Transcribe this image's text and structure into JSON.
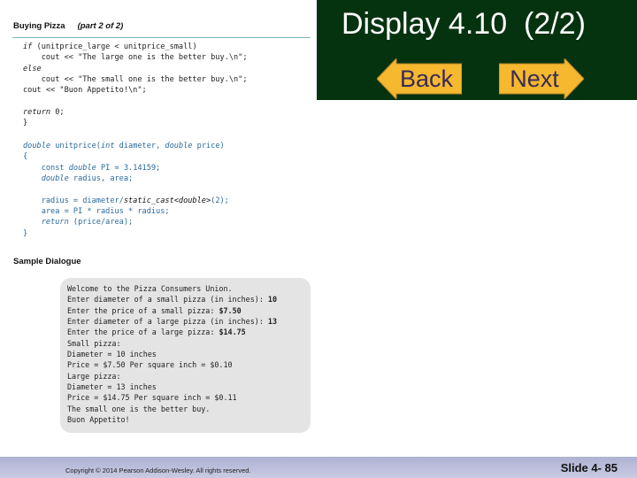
{
  "header": {
    "title": "Display 4.10  (2/2)",
    "back_label": "Back",
    "next_label": "Next",
    "panel_color": "#053310",
    "button_color": "#f5b82e"
  },
  "document": {
    "title": "Buying Pizza",
    "part": "(part 2 of 2)",
    "code_block_1": [
      [
        [
          "if",
          "k"
        ],
        [
          " (unitprice_large < unitprice_small)",
          ""
        ]
      ],
      [
        [
          "    cout << \"The large one is the better buy.\\n\";",
          ""
        ]
      ],
      [
        [
          "else",
          "k"
        ]
      ],
      [
        [
          "    cout << \"The small one is the better buy.\\n\";",
          ""
        ]
      ],
      [
        [
          "cout << \"Buon Appetito!\\n\";",
          ""
        ]
      ],
      [
        [
          "",
          ""
        ]
      ],
      [
        [
          "return",
          "k"
        ],
        [
          " 0;",
          ""
        ]
      ],
      [
        [
          "}",
          ""
        ]
      ]
    ],
    "code_block_2": [
      [
        [
          "double",
          "k"
        ],
        [
          " unitprice(",
          ""
        ],
        [
          "int",
          "k"
        ],
        [
          " diameter, ",
          ""
        ],
        [
          "double",
          "k"
        ],
        [
          " price)",
          ""
        ]
      ],
      [
        [
          "{",
          ""
        ]
      ],
      [
        [
          "    const ",
          ""
        ],
        [
          "double",
          "k"
        ],
        [
          " PI = 3.14159;",
          ""
        ]
      ],
      [
        [
          "    ",
          ""
        ],
        [
          "double",
          "k"
        ],
        [
          " radius, area;",
          ""
        ]
      ],
      [
        [
          "",
          ""
        ]
      ],
      [
        [
          "    radius = diameter/",
          ""
        ],
        [
          "static_cast<double>",
          "b"
        ],
        [
          "(2);",
          ""
        ]
      ],
      [
        [
          "    area = PI * radius * radius;",
          ""
        ]
      ],
      [
        [
          "    ",
          ""
        ],
        [
          "return",
          "k"
        ],
        [
          " (price/area);",
          ""
        ]
      ],
      [
        [
          "}",
          ""
        ]
      ]
    ],
    "sample_title": "Sample Dialogue",
    "dialogue": [
      [
        [
          "Welcome to the Pizza Consumers Union.",
          ""
        ]
      ],
      [
        [
          "Enter diameter of a small pizza (in inches): ",
          ""
        ],
        [
          "10",
          "b"
        ]
      ],
      [
        [
          "Enter the price of a small pizza: ",
          ""
        ],
        [
          "$7.50",
          "b"
        ]
      ],
      [
        [
          "Enter diameter of a large pizza (in inches): ",
          ""
        ],
        [
          "13",
          "b"
        ]
      ],
      [
        [
          "Enter the price of a large pizza: ",
          ""
        ],
        [
          "$14.75",
          "b"
        ]
      ],
      [
        [
          "Small pizza:",
          ""
        ]
      ],
      [
        [
          "Diameter = 10 inches",
          ""
        ]
      ],
      [
        [
          "Price = $7.50 Per square inch = $0.10",
          ""
        ]
      ],
      [
        [
          "Large pizza:",
          ""
        ]
      ],
      [
        [
          "Diameter = 13 inches",
          ""
        ]
      ],
      [
        [
          "Price = $14.75 Per square inch = $0.11",
          ""
        ]
      ],
      [
        [
          "The small one is the better buy.",
          ""
        ]
      ],
      [
        [
          "Buon Appetito!",
          ""
        ]
      ]
    ]
  },
  "footer": {
    "copyright": "Copyright © 2014 Pearson Addison-Wesley.  All rights reserved.",
    "slide_number": "Slide 4- 85"
  }
}
